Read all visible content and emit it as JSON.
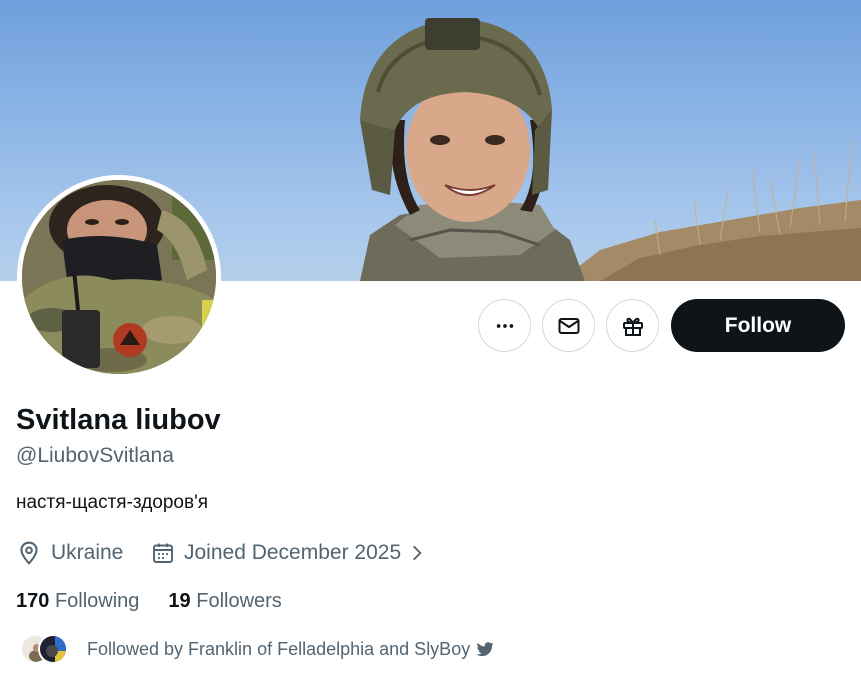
{
  "profile": {
    "name": "Svitlana liubov",
    "handle": "@LiubovSvitlana",
    "bio": "настя-щастя-здоров'я",
    "location": "Ukraine",
    "joined": "Joined December 2025"
  },
  "actions": {
    "follow_label": "Follow",
    "more_icon": "more-icon",
    "message_icon": "mail-icon",
    "gift_icon": "gift-icon"
  },
  "stats": {
    "following_count": "170",
    "following_label": "Following",
    "followers_count": "19",
    "followers_label": "Followers"
  },
  "followed_by": {
    "text": "Followed by Franklin of Felladelphia and SlyBoy"
  },
  "colors": {
    "follow_button": "#0f1419",
    "secondary_text": "#536471",
    "border": "#cfd9de"
  }
}
